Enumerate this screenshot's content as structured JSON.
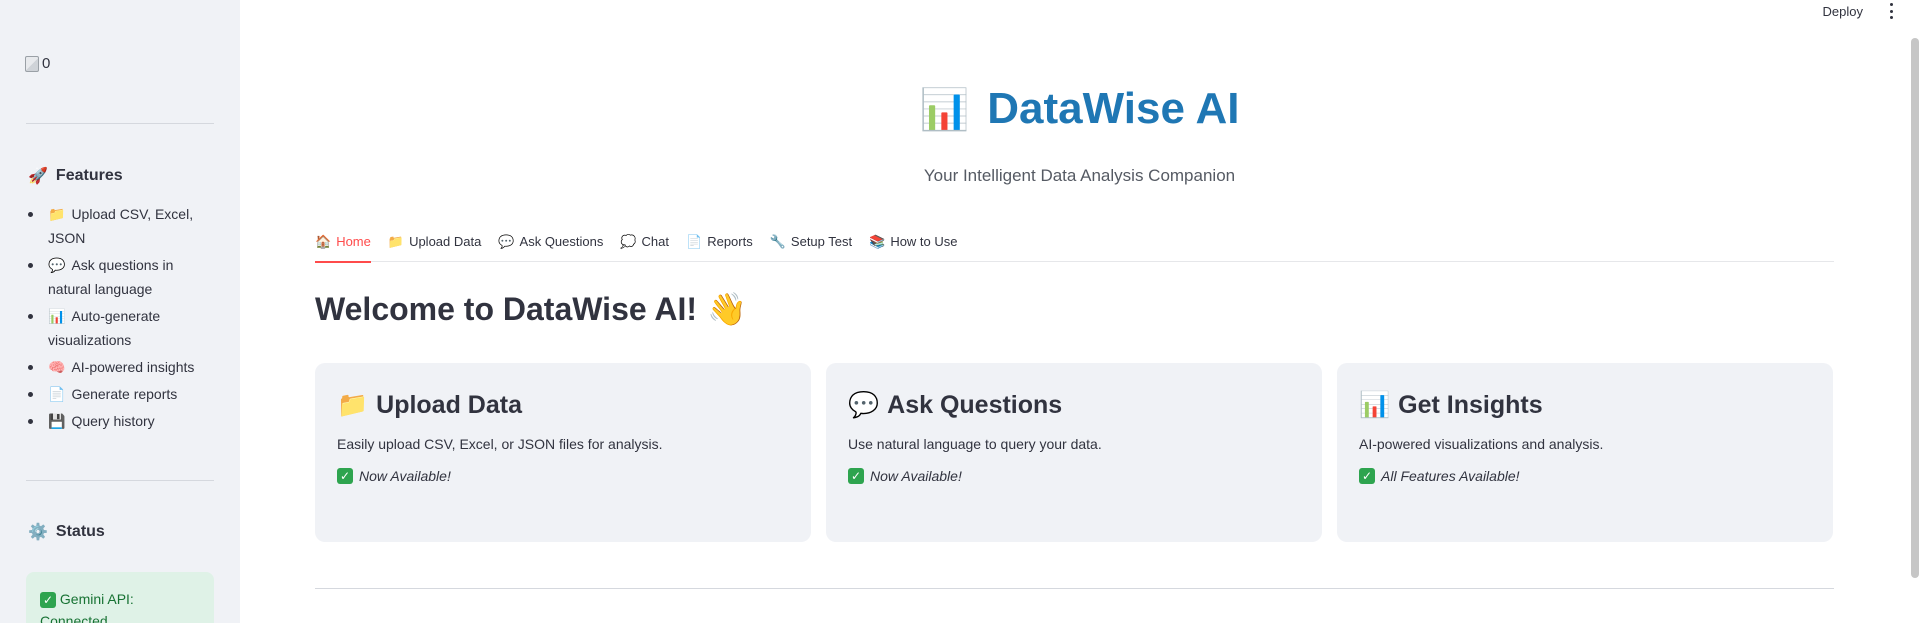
{
  "sidebar": {
    "logo_alt": "0",
    "features_heading": "Features",
    "features_icon": "rocket",
    "features": [
      {
        "icon": "📁",
        "label": "Upload CSV, Excel, JSON"
      },
      {
        "icon": "💬",
        "label": "Ask questions in natural language"
      },
      {
        "icon": "📊",
        "label": "Auto-generate visualizations"
      },
      {
        "icon": "🧠",
        "label": "AI-powered insights"
      },
      {
        "icon": "📄",
        "label": "Generate reports"
      },
      {
        "icon": "💾",
        "label": "Query history"
      }
    ],
    "status_heading": "Status",
    "status_icon": "gear",
    "status_text": "Gemini API: Connected"
  },
  "topbar": {
    "deploy_label": "Deploy"
  },
  "hero": {
    "icon": "📊",
    "title": "DataWise AI",
    "subtitle": "Your Intelligent Data Analysis Companion",
    "title_color": "#1f77b4"
  },
  "tabs": [
    {
      "icon": "🏠",
      "label": "Home",
      "active": true
    },
    {
      "icon": "📁",
      "label": "Upload Data"
    },
    {
      "icon": "💬",
      "label": "Ask Questions"
    },
    {
      "icon": "💭",
      "label": "Chat"
    },
    {
      "icon": "📄",
      "label": "Reports"
    },
    {
      "icon": "🔧",
      "label": "Setup Test"
    },
    {
      "icon": "📚",
      "label": "How to Use"
    }
  ],
  "welcome": {
    "title": "Welcome to DataWise AI!",
    "icon": "👋"
  },
  "cards": [
    {
      "icon": "📁",
      "title": "Upload Data",
      "desc": "Easily upload CSV, Excel, or JSON files for analysis.",
      "status": "Now Available!"
    },
    {
      "icon": "💬",
      "title": "Ask Questions",
      "desc": "Use natural language to query your data.",
      "status": "Now Available!"
    },
    {
      "icon": "📊",
      "title": "Get Insights",
      "desc": "AI-powered visualizations and analysis.",
      "status": "All Features Available!"
    }
  ],
  "colors": {
    "accent": "#ff4b4b",
    "sidebar_bg": "#f0f2f6",
    "success_bg": "#dff2e7",
    "success_text": "#177233"
  }
}
